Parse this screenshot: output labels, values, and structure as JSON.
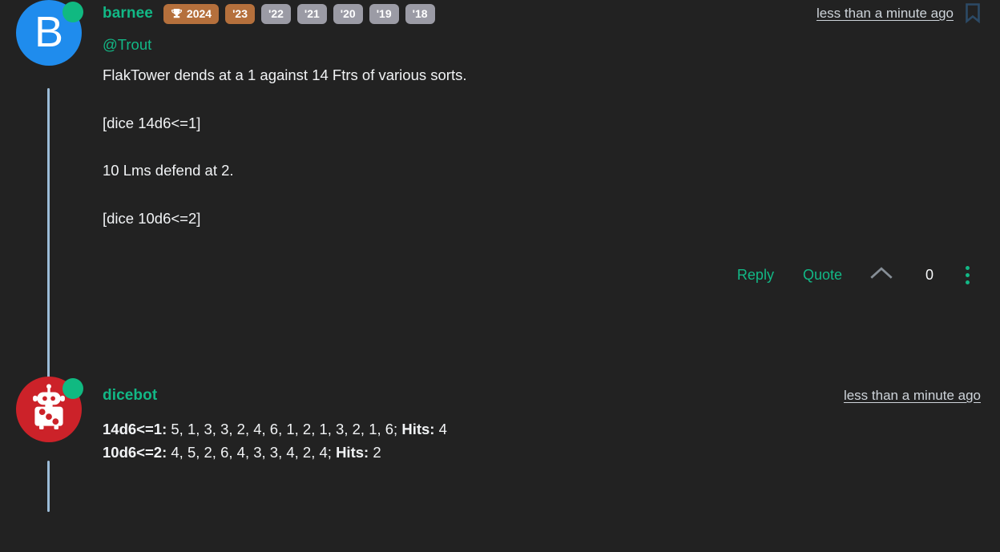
{
  "theme": {
    "background": "#222222",
    "accent_green": "#12b886",
    "text": "#f1f3f5",
    "badge_bronze": "#b5703c",
    "badge_grey": "#9b9ba5",
    "avatar_blue": "#1f8ced",
    "avatar_red": "#cc2229",
    "thread_line": "#9cbcd8",
    "bookmark": "#2c4a66"
  },
  "posts": [
    {
      "author": "barnee",
      "avatar": {
        "type": "letter",
        "letter": "B",
        "color": "#1f8ced",
        "status": "online"
      },
      "badges": [
        {
          "label": "2024",
          "icon": "trophy-icon",
          "style": "bronze"
        },
        {
          "label": "'23",
          "style": "bronze"
        },
        {
          "label": "'22",
          "style": "grey"
        },
        {
          "label": "'21",
          "style": "grey"
        },
        {
          "label": "'20",
          "style": "grey"
        },
        {
          "label": "'19",
          "style": "grey"
        },
        {
          "label": "'18",
          "style": "grey"
        }
      ],
      "timestamp": "less than a minute ago",
      "bookmark_icon": "bookmark-icon",
      "mention": "@Trout",
      "paragraphs": [
        "FlakTower dends at a 1 against 14 Ftrs of various sorts.",
        "[dice 14d6<=1]",
        "10 Lms defend at 2.",
        "[dice 10d6<=2]"
      ],
      "actions": {
        "reply_label": "Reply",
        "quote_label": "Quote",
        "upvote_icon": "chevron-up-icon",
        "vote_count": "0",
        "more_icon": "kebab-menu-icon"
      }
    },
    {
      "author": "dicebot",
      "avatar": {
        "type": "robot-dice-icon",
        "color": "#cc2229",
        "status": "online"
      },
      "timestamp": "less than a minute ago",
      "dice_results": [
        {
          "roll": "14d6<=1:",
          "values": "5, 1, 3, 3, 2, 4, 6, 1, 2, 1, 3, 2, 1, 6;",
          "hits_label": "Hits:",
          "hits": "4"
        },
        {
          "roll": "10d6<=2:",
          "values": "4, 5, 2, 6, 4, 3, 3, 4, 2, 4;",
          "hits_label": "Hits:",
          "hits": "2"
        }
      ]
    }
  ]
}
